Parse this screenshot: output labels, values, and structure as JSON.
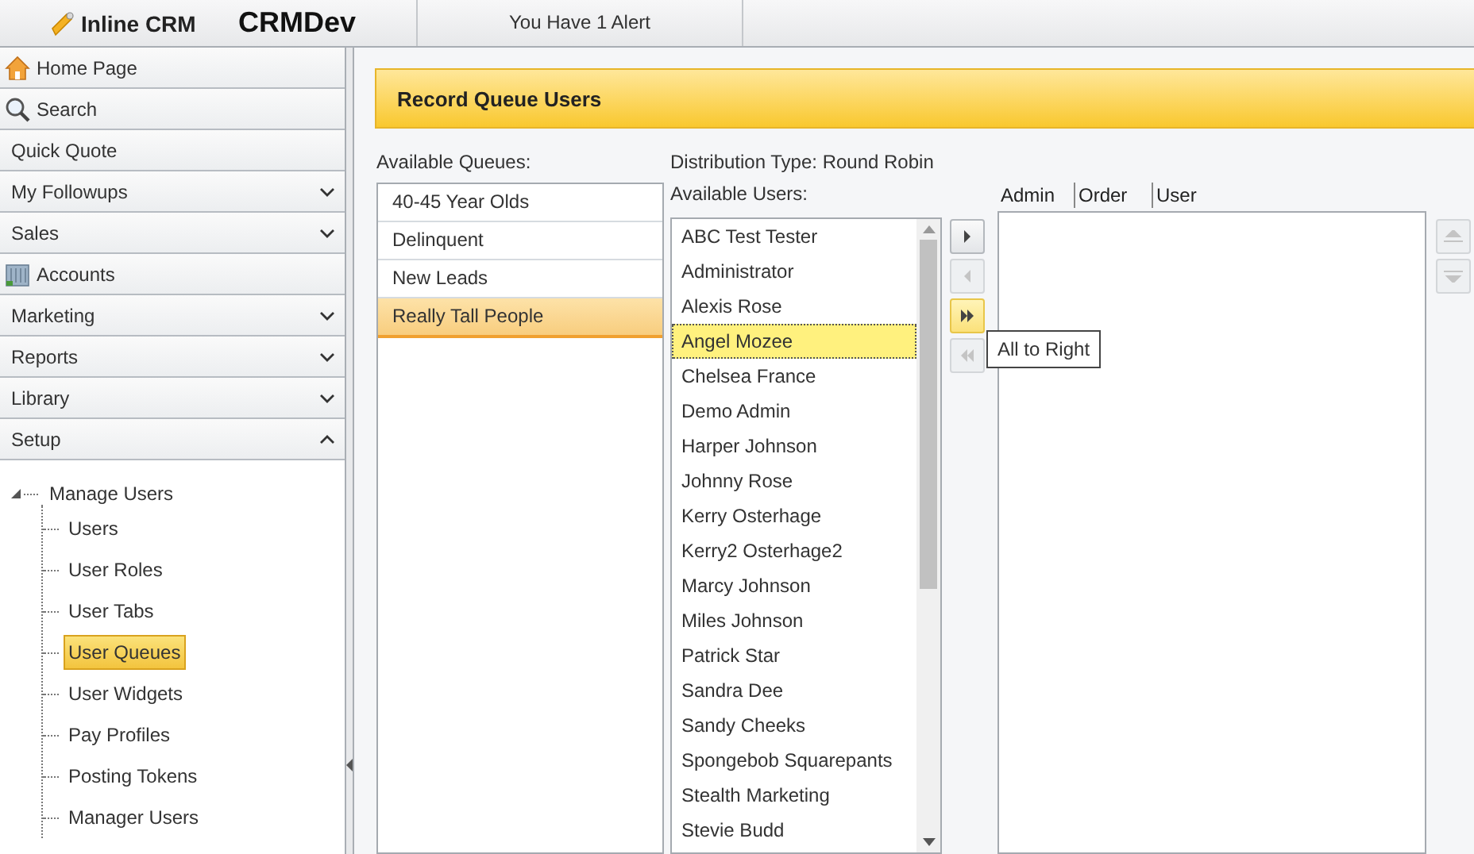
{
  "top_bar": {
    "app_name": "Inline CRM",
    "instance": "CRMDev",
    "alert": "You Have 1 Alert"
  },
  "sidebar": {
    "items": [
      {
        "label": "Home Page",
        "kind": "home"
      },
      {
        "label": "Search",
        "kind": "search"
      },
      {
        "label": "Quick Quote",
        "kind": "plain"
      },
      {
        "label": "My Followups",
        "kind": "group",
        "expanded": false
      },
      {
        "label": "Sales",
        "kind": "group",
        "expanded": false
      },
      {
        "label": "Accounts",
        "kind": "accounts"
      },
      {
        "label": "Marketing",
        "kind": "group",
        "expanded": false
      },
      {
        "label": "Reports",
        "kind": "group",
        "expanded": false
      },
      {
        "label": "Library",
        "kind": "group",
        "expanded": false
      },
      {
        "label": "Setup",
        "kind": "group",
        "expanded": true
      }
    ],
    "tree": [
      {
        "label": "Manage Users",
        "expanded": true,
        "children": [
          {
            "label": "Users",
            "selected": false
          },
          {
            "label": "User Roles",
            "selected": false
          },
          {
            "label": "User Tabs",
            "selected": false
          },
          {
            "label": "User Queues",
            "selected": true
          },
          {
            "label": "User Widgets",
            "selected": false
          },
          {
            "label": "Pay Profiles",
            "selected": false
          },
          {
            "label": "Posting Tokens",
            "selected": false
          },
          {
            "label": "Manager Users",
            "selected": false
          }
        ]
      }
    ]
  },
  "page": {
    "title": "Record Queue Users",
    "queues": {
      "label": "Available Queues:",
      "items": [
        {
          "label": "40-45 Year Olds",
          "selected": false
        },
        {
          "label": "Delinquent",
          "selected": false
        },
        {
          "label": "New Leads",
          "selected": false
        },
        {
          "label": "Really Tall People",
          "selected": true
        }
      ]
    },
    "distribution_type": "Distribution Type: Round Robin",
    "users": {
      "label": "Available Users:",
      "items": [
        {
          "label": "ABC Test Tester",
          "selected": false
        },
        {
          "label": "Administrator",
          "selected": false
        },
        {
          "label": "Alexis Rose",
          "selected": false
        },
        {
          "label": "Angel Mozee",
          "selected": true
        },
        {
          "label": "Chelsea France",
          "selected": false
        },
        {
          "label": "Demo Admin",
          "selected": false
        },
        {
          "label": "Harper Johnson",
          "selected": false
        },
        {
          "label": "Johnny Rose",
          "selected": false
        },
        {
          "label": "Kerry Osterhage",
          "selected": false
        },
        {
          "label": "Kerry2 Osterhage2",
          "selected": false
        },
        {
          "label": "Marcy Johnson",
          "selected": false
        },
        {
          "label": "Miles Johnson",
          "selected": false
        },
        {
          "label": "Patrick Star",
          "selected": false
        },
        {
          "label": "Sandra Dee",
          "selected": false
        },
        {
          "label": "Sandy Cheeks",
          "selected": false
        },
        {
          "label": "Spongebob Squarepants",
          "selected": false
        },
        {
          "label": "Stealth Marketing",
          "selected": false
        },
        {
          "label": "Stevie Budd",
          "selected": false
        }
      ]
    },
    "transfer_buttons": [
      {
        "kind": "right",
        "disabled": false,
        "hovered": false
      },
      {
        "kind": "left",
        "disabled": true,
        "hovered": false
      },
      {
        "kind": "all-right",
        "disabled": false,
        "hovered": true
      },
      {
        "kind": "all-left",
        "disabled": true,
        "hovered": false
      }
    ],
    "tooltip": "All to Right",
    "assigned": {
      "columns": [
        "Admin",
        "Order",
        "User"
      ]
    },
    "order_buttons": [
      {
        "kind": "up",
        "disabled": true
      },
      {
        "kind": "down",
        "disabled": true
      }
    ]
  }
}
